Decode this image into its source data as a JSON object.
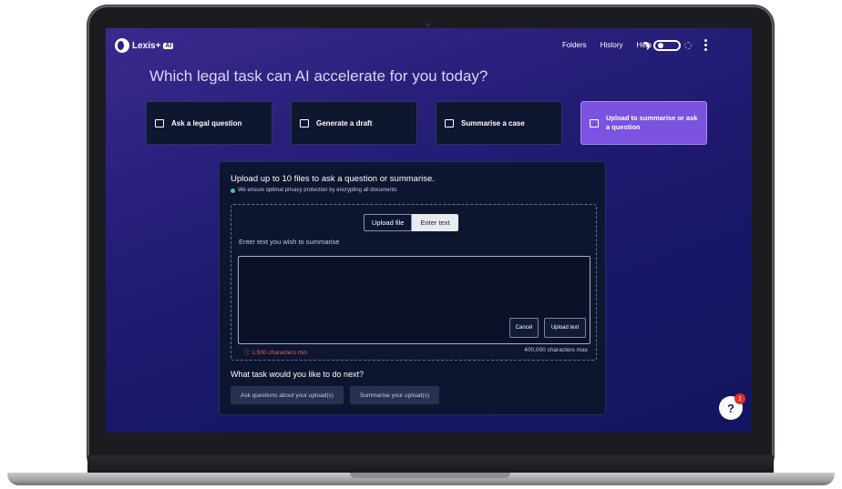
{
  "brand": {
    "name": "Lexis+",
    "badge": "AI"
  },
  "nav": {
    "folders": "Folders",
    "history": "History",
    "help": "Help"
  },
  "headline": "Which legal task can AI accelerate for you today?",
  "tasks": [
    {
      "label": "Ask a legal question",
      "icon": "chat-icon"
    },
    {
      "label": "Generate a draft",
      "icon": "draft-icon"
    },
    {
      "label": "Summarise a case",
      "icon": "list-icon"
    },
    {
      "label": "Upload to summarise or ask a question",
      "icon": "upload-icon",
      "active": true
    }
  ],
  "upload": {
    "title": "Upload up to 10 files to ask a question or summarise.",
    "privacy": "We ensure optimal privacy protection by encrypting all documents",
    "tabs": {
      "upload_file": "Upload file",
      "enter_text": "Enter text"
    },
    "textarea_label": "Enter text you wish to summarise",
    "cancel": "Cancel",
    "upload_text": "Upload text",
    "min": "ⓘ 1,500 characters min",
    "max": "400,000 characters max"
  },
  "next": {
    "title": "What task would you like to do next?",
    "ask": "Ask questions about your upload(s)",
    "summarise": "Summarise your upload(s)"
  },
  "help_widget": {
    "label": "?",
    "badge": "1"
  },
  "colors": {
    "accent": "#7b53e0",
    "background": "#1a176a",
    "error": "#e2655b"
  }
}
